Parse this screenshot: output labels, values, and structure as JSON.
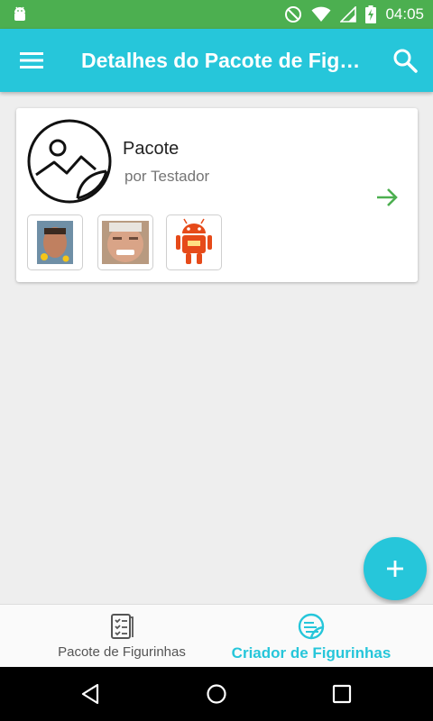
{
  "status_bar": {
    "time": "04:05"
  },
  "app_bar": {
    "title": "Detalhes do Pacote de Figurinhas"
  },
  "pack": {
    "name": "Pacote",
    "author": "por Testador",
    "stickers": [
      {
        "label": "sticker-face-emoji"
      },
      {
        "label": "sticker-older-man"
      },
      {
        "label": "sticker-android-robot"
      }
    ]
  },
  "bottom_nav": {
    "items": [
      {
        "label": "Pacote de Figurinhas"
      },
      {
        "label": "Criador de Figurinhas"
      }
    ]
  },
  "colors": {
    "accent": "#26c6da",
    "status_bar": "#4caf50",
    "arrow": "#4caf50"
  }
}
